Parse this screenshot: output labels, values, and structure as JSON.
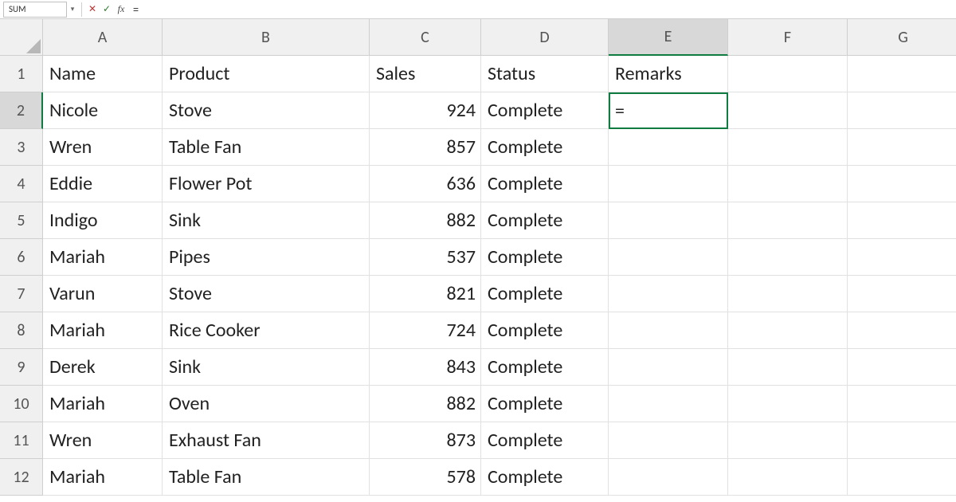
{
  "formula_bar": {
    "name_box": "SUM",
    "formula": "="
  },
  "columns": [
    "A",
    "B",
    "C",
    "D",
    "E",
    "F",
    "G"
  ],
  "active_col_index": 4,
  "active_row_index": 1,
  "active_cell_value": "=",
  "headers": {
    "A": "Name",
    "B": "Product",
    "C": "Sales",
    "D": "Status",
    "E": "Remarks"
  },
  "rows": [
    {
      "n": "1"
    },
    {
      "n": "2",
      "A": "Nicole",
      "B": "Stove",
      "C": "924",
      "D": "Complete"
    },
    {
      "n": "3",
      "A": "Wren",
      "B": "Table Fan",
      "C": "857",
      "D": "Complete"
    },
    {
      "n": "4",
      "A": "Eddie",
      "B": "Flower Pot",
      "C": "636",
      "D": "Complete"
    },
    {
      "n": "5",
      "A": "Indigo",
      "B": "Sink",
      "C": "882",
      "D": "Complete"
    },
    {
      "n": "6",
      "A": "Mariah",
      "B": "Pipes",
      "C": "537",
      "D": "Complete"
    },
    {
      "n": "7",
      "A": "Varun",
      "B": "Stove",
      "C": "821",
      "D": "Complete"
    },
    {
      "n": "8",
      "A": "Mariah",
      "B": "Rice Cooker",
      "C": "724",
      "D": "Complete"
    },
    {
      "n": "9",
      "A": "Derek",
      "B": "Sink",
      "C": "843",
      "D": "Complete"
    },
    {
      "n": "10",
      "A": "Mariah",
      "B": "Oven",
      "C": "882",
      "D": "Complete"
    },
    {
      "n": "11",
      "A": "Wren",
      "B": "Exhaust Fan",
      "C": "873",
      "D": "Complete"
    },
    {
      "n": "12",
      "A": "Mariah",
      "B": "Table Fan",
      "C": "578",
      "D": "Complete"
    }
  ]
}
